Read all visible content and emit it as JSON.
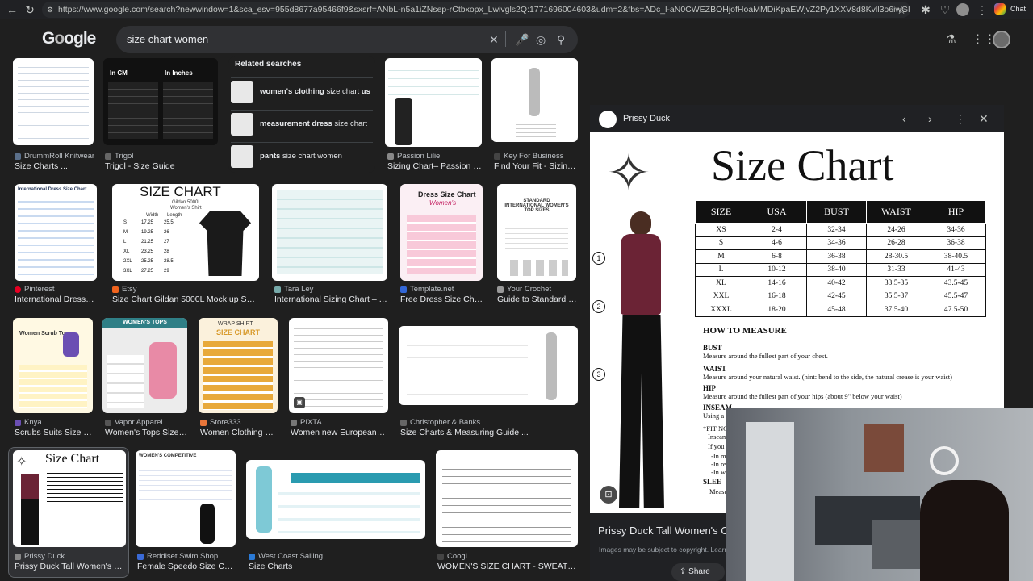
{
  "browser": {
    "url": "https://www.google.com/search?newwindow=1&sca_esv=955d8677a95466f9&sxsrf=ANbL-n5a1iZNsep-rCtbxopx_Lwivgls2Q:1771696004603&udm=2&fbs=ADc_l-aN0CWEZBOHjofHoaMMDiKpaEWjvZ2Py1XXV8d8Kvll3o6iwGk6lv1tRbZIBNIVs-5-bUj3...",
    "chat_label": "Chat"
  },
  "search": {
    "query": "size chart women"
  },
  "related": {
    "heading": "Related searches",
    "items": [
      {
        "bold": "women's clothing",
        "rest": " size chart ",
        "bold2": "us"
      },
      {
        "bold": "measurement dress",
        "rest": " size chart",
        "bold2": ""
      },
      {
        "bold": "pants",
        "rest": " size chart women",
        "bold2": ""
      }
    ]
  },
  "results": {
    "r1": [
      {
        "source": "DrummRoll Knitwear",
        "title": "Size Charts ..."
      },
      {
        "source": "Trigol",
        "title": "Trigol - Size Guide"
      },
      {
        "source": "Passion Lilie",
        "title": "Sizing Chart– Passion Li..."
      },
      {
        "source": "Key For Business",
        "title": "Find Your Fit - Sizing ..."
      }
    ],
    "r2": [
      {
        "source": "Pinterest",
        "title": "International Dress Si..."
      },
      {
        "source": "Etsy",
        "title": "Size Chart Gildan 5000L Mock up Shirt ..."
      },
      {
        "source": "Tara Ley",
        "title": "International Sizing Chart – Ta..."
      },
      {
        "source": "Template.net",
        "title": "Free Dress Size Chart ..."
      },
      {
        "source": "Your Crochet",
        "title": "Guide to Standard W..."
      }
    ],
    "r3": [
      {
        "source": "Knya",
        "title": "Scrubs Suits Size C..."
      },
      {
        "source": "Vapor Apparel",
        "title": "Women's Tops Size C..."
      },
      {
        "source": "Store333",
        "title": "Women Clothing Siz..."
      },
      {
        "source": "PIXTA",
        "title": "Women new European sy..."
      },
      {
        "source": "Christopher & Banks",
        "title": "Size Charts & Measuring Guide ..."
      }
    ],
    "r4": [
      {
        "source": "Prissy Duck",
        "title": "Prissy Duck Tall Women's Clo..."
      },
      {
        "source": "Reddiset Swim Shop",
        "title": "Female Speedo Size Charts"
      },
      {
        "source": "West Coast Sailing",
        "title": "Size Charts"
      },
      {
        "source": "Coogi",
        "title": "WOMEN'S SIZE CHART - SWEATERS – ..."
      }
    ]
  },
  "thumb_text": {
    "gildan_title": "SIZE CHART",
    "gildan_sub": "Gildan 5000L",
    "gildan_sub2": "Women's Shirt",
    "gildan_cols": [
      "Width",
      "Length"
    ],
    "gildan_rows": [
      [
        "S",
        "17.25",
        "25.5"
      ],
      [
        "M",
        "19.25",
        "26"
      ],
      [
        "L",
        "21.25",
        "27"
      ],
      [
        "XL",
        "23.25",
        "28"
      ],
      [
        "2XL",
        "25.25",
        "28.5"
      ],
      [
        "3XL",
        "27.25",
        "29"
      ]
    ],
    "intl_title": "International Dress Size Chart",
    "dress_title": "Dress Size Chart",
    "dress_sub": "Women's",
    "crochet_title": "STANDARD INTERNATIONAL WOMEN'S TOP SIZES",
    "wrap_title": "WRAP SHIRT",
    "wrap_sub": "SIZE CHART",
    "vapor_title": "WOMEN'S TOPS",
    "knya_title": "Women Scrub Top",
    "competitive_title": "WOMEN'S COMPETITIVE",
    "prissy_small": "Size Chart"
  },
  "panel": {
    "source": "Prissy Duck",
    "title": "Prissy Duck Tall Women's Clot",
    "notice": "Images may be subject to copyright. Learn M",
    "share_label": "Share",
    "chart_title": "Size Chart",
    "headers": [
      "SIZE",
      "USA",
      "BUST",
      "WAIST",
      "HIP"
    ],
    "rows": [
      [
        "XS",
        "2-4",
        "32-34",
        "24-26",
        "34-36"
      ],
      [
        "S",
        "4-6",
        "34-36",
        "26-28",
        "36-38"
      ],
      [
        "M",
        "6-8",
        "36-38",
        "28-30.5",
        "38-40.5"
      ],
      [
        "L",
        "10-12",
        "38-40",
        "31-33",
        "41-43"
      ],
      [
        "XL",
        "14-16",
        "40-42",
        "33.5-35",
        "43.5-45"
      ],
      [
        "XXL",
        "16-18",
        "42-45",
        "35.5-37",
        "45.5-47"
      ],
      [
        "XXXL",
        "18-20",
        "45-48",
        "37.5-40",
        "47.5-50"
      ]
    ],
    "how_to": "HOW TO MEASURE",
    "measures": [
      {
        "name": "BUST",
        "text": "Measure around the fullest part of your chest."
      },
      {
        "name": "WAIST",
        "text": "Measure around your natural waist. (hint: bend to the side, the natural crease is your waist)"
      },
      {
        "name": "HIP",
        "text": "Measure around the fullest part of your hips (about 9\" below your waist)"
      },
      {
        "name": "INSEAM",
        "text": "Using a"
      }
    ],
    "fit_note": "*FIT NO",
    "fit_lines": [
      "Inseam",
      "If you",
      "-In m",
      "-In re",
      "-In w"
    ],
    "sleeve": "SLEE",
    "sleeve_text": "Measu",
    "markers": [
      "1",
      "2",
      "3"
    ]
  },
  "colors": {
    "bg": "#1f1f1f",
    "accent": "#8ab4f8",
    "pinterest": "#e60023",
    "etsy": "#f1641e"
  }
}
